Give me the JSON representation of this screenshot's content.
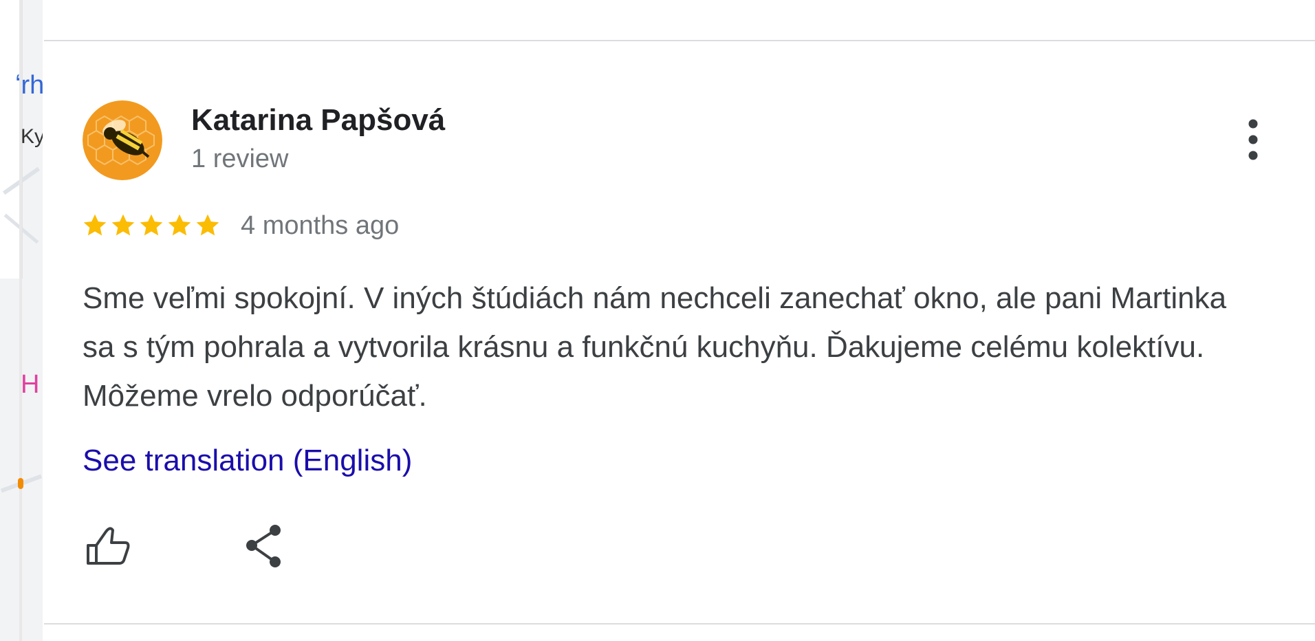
{
  "map_fragments": {
    "blue_text": "ʻrh",
    "black_text": "Ky",
    "pink_text": "H"
  },
  "review": {
    "reviewer_name": "Katarina Papšová",
    "review_count": "1 review",
    "rating": 5,
    "rating_max": 5,
    "time_ago": "4 months ago",
    "text": "Sme veľmi spokojní. V iných štúdiách nám nechceli zanechať okno, ale pani Martinka sa s tým pohrala a vytvorila krásnu a funkčnú kuchyňu. Ďakujeme celému kolektívu. Môžeme vrelo odporúčať.",
    "see_translation_label": "See translation (English)",
    "icons": {
      "avatar": "bee-avatar",
      "more": "more-vertical-icon",
      "like": "thumbs-up-icon",
      "share": "share-icon",
      "star": "star-icon"
    }
  },
  "colors": {
    "star": "#fbbc04",
    "link": "#1a0dab",
    "secondary_text": "#70757a",
    "divider": "#dadce0"
  }
}
